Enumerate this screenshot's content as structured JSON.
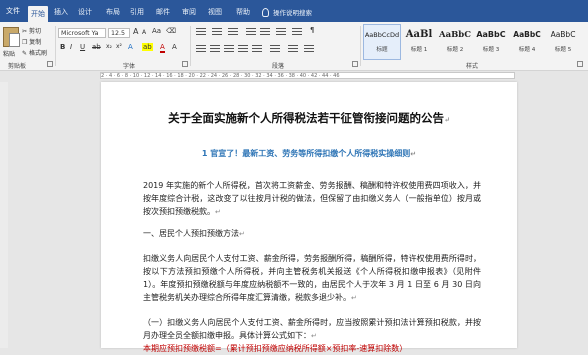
{
  "ribbon_tabs": {
    "file": "文件",
    "tabs": [
      "开始",
      "插入",
      "设计",
      "布局",
      "引用",
      "邮件",
      "审阅",
      "视图",
      "帮助",
      "格式"
    ],
    "active": "开始",
    "tell_me": "操作说明搜索"
  },
  "clipboard": {
    "paste": "粘贴",
    "cut": "剪切",
    "copy": "复制",
    "format_painter": "格式刷",
    "label": "剪贴板"
  },
  "font": {
    "name": "Microsoft Ya",
    "size": "12.5",
    "grow": "A",
    "shrink": "A",
    "bold": "B",
    "italic": "I",
    "underline": "U",
    "label": "字体"
  },
  "paragraph": {
    "label": "段落"
  },
  "styles": {
    "label": "样式",
    "items": [
      {
        "sample": "AaBbCcDd",
        "name": "标题"
      },
      {
        "sample": "AaBl",
        "name": "标题 1"
      },
      {
        "sample": "AaBbC",
        "name": "标题 2"
      },
      {
        "sample": "AaBbC",
        "name": "标题 3"
      },
      {
        "sample": "AaBbC",
        "name": "标题 4"
      },
      {
        "sample": "AaBbC",
        "name": "标题 5"
      }
    ]
  },
  "ruler": {
    "marks": "2 · 4 · 6 · 8 · 10 · 12 · 14 · 16 · 18 · 20 · 22 · 24 · 26 · 28 · 30 · 32 · 34 · 36 · 38 · 40 · 42 · 44 · 46"
  },
  "document": {
    "title": "关于全面实施新个人所得税法若干征管衔接问题的公告",
    "subtitle": "1 官宣了！最新工资、劳务等所得扣缴个人所得税实操细则",
    "para_mark": "↵",
    "paragraphs": [
      "2019 年实施的新个人所得税，首次将工资薪金、劳务报酬、稿酬和特许权使用费四项收入，并按年度综合计税，这改变了以往按月计税的做法，但保留了由扣缴义务人（一般指单位）按月或按次预扣预缴税款。",
      "一、居民个人预扣预缴方法",
      "扣缴义务人向居民个人支付工资、薪金所得，劳务报酬所得，稿酬所得，特许权使用费所得时，按以下方法预扣预缴个人所得税，并向主管税务机关报送《个人所得税扣缴申报表》（见附件 1）。年度预扣预缴税额与年度应纳税额不一致的，由居民个人于次年 3 月 1 日至 6 月 30 日向主管税务机关办理综合所得年度汇算清缴，税款多退少补。",
      "（一）扣缴义务人向居民个人支付工资、薪金所得时，应当按照累计预扣法计算预扣税款，并按月办理全员全额扣缴申报。具体计算公式如下：",
      "本期应预扣预缴税额=（累计预扣预缴应纳税所得额×预扣率-速算扣除数）"
    ]
  }
}
